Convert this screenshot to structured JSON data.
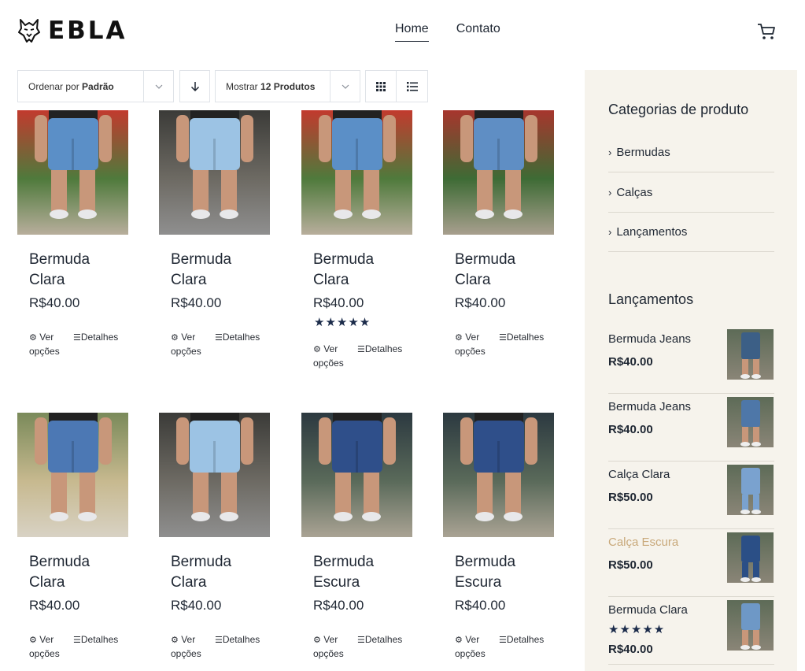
{
  "brand": {
    "name": "EBLA",
    "logo_icon": "wolf-head-icon"
  },
  "nav": {
    "home": "Home",
    "contato": "Contato",
    "cart_icon": "cart-icon"
  },
  "toolbar": {
    "sort_prefix": "Ordenar por",
    "sort_value": "Padrão",
    "show_prefix": "Mostrar",
    "show_value": "12 Produtos",
    "direction_icon": "arrow-down-icon",
    "grid_icon": "grid-view-icon",
    "list_icon": "list-view-icon"
  },
  "products": [
    {
      "name": "Bermuda Clara",
      "price": "R$40.00",
      "rating": 0,
      "action_options": "Ver opções",
      "action_details": "Detalhes",
      "tone": "light"
    },
    {
      "name": "Bermuda Clara",
      "price": "R$40.00",
      "rating": 0,
      "action_options": "Ver opções",
      "action_details": "Detalhes",
      "tone": "pale"
    },
    {
      "name": "Bermuda Clara",
      "price": "R$40.00",
      "rating": 5,
      "action_options": "Ver opções",
      "action_details": "Detalhes",
      "tone": "light"
    },
    {
      "name": "Bermuda Clara",
      "price": "R$40.00",
      "rating": 0,
      "action_options": "Ver opções",
      "action_details": "Detalhes",
      "tone": "mid"
    },
    {
      "name": "Bermuda Clara",
      "price": "R$40.00",
      "rating": 0,
      "action_options": "Ver opções",
      "action_details": "Detalhes",
      "tone": "ripped"
    },
    {
      "name": "Bermuda Clara",
      "price": "R$40.00",
      "rating": 0,
      "action_options": "Ver opções",
      "action_details": "Detalhes",
      "tone": "pale"
    },
    {
      "name": "Bermuda Escura",
      "price": "R$40.00",
      "rating": 0,
      "action_options": "Ver opções",
      "action_details": "Detalhes",
      "tone": "dark"
    },
    {
      "name": "Bermuda Escura",
      "price": "R$40.00",
      "rating": 0,
      "action_options": "Ver opções",
      "action_details": "Detalhes",
      "tone": "dark"
    }
  ],
  "sidebar": {
    "categories_title": "Categorias de produto",
    "categories": [
      "Bermudas",
      "Calças",
      "Lançamentos"
    ],
    "launches_title": "Lançamentos",
    "launches": [
      {
        "name": "Bermuda Jeans",
        "price": "R$40.00",
        "rating": 0,
        "highlighted": false
      },
      {
        "name": "Bermuda Jeans",
        "price": "R$40.00",
        "rating": 0,
        "highlighted": false
      },
      {
        "name": "Calça Clara",
        "price": "R$50.00",
        "rating": 0,
        "highlighted": false
      },
      {
        "name": "Calça Escura",
        "price": "R$50.00",
        "rating": 0,
        "highlighted": true
      },
      {
        "name": "Bermuda Clara",
        "price": "R$40.00",
        "rating": 5,
        "highlighted": false
      }
    ]
  },
  "colors": {
    "accent_gold": "#c9a97b",
    "sidebar_bg": "#f6f3ec",
    "star_navy": "#1b2b4a"
  }
}
